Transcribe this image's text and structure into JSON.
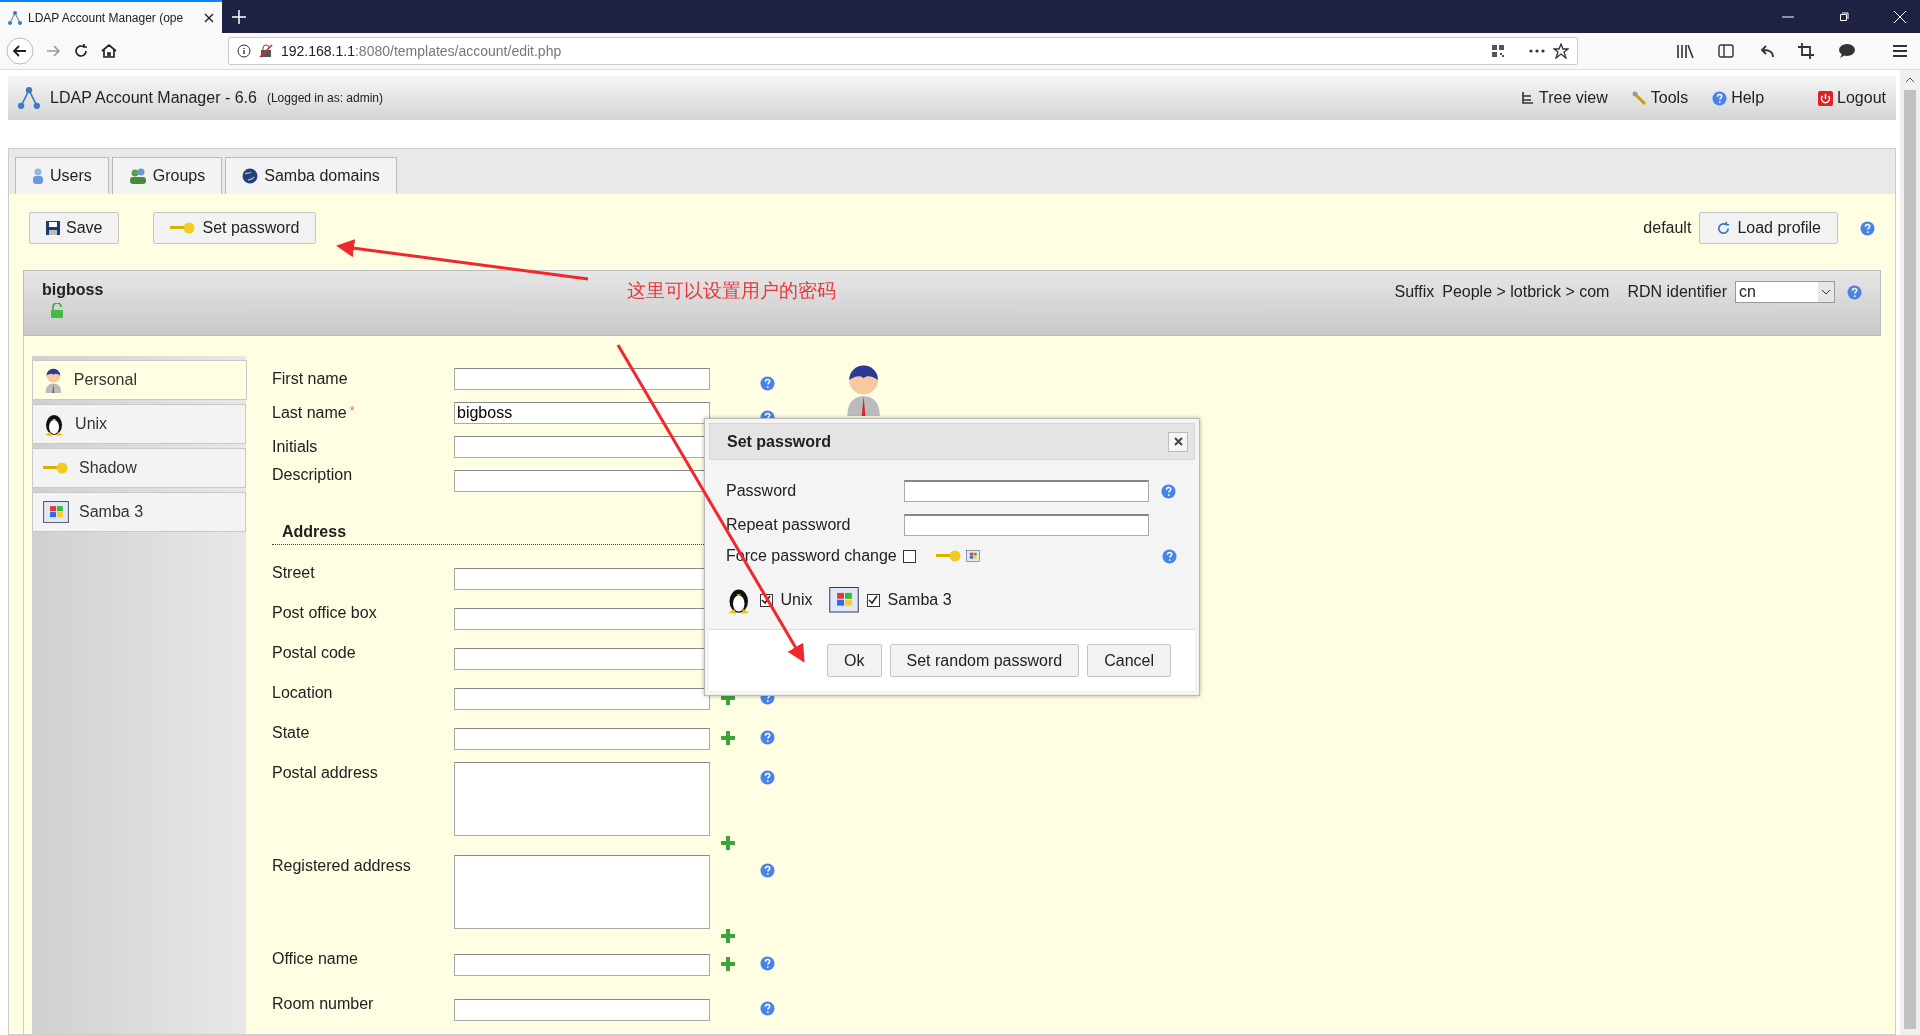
{
  "browser": {
    "tab_title": "LDAP Account Manager (ope",
    "url_host": "192.168.1.1",
    "url_rest": ":8080/templates/account/edit.php"
  },
  "app": {
    "title": "LDAP Account Manager - 6.6",
    "logged_in": "(Logged in as: admin)",
    "links": [
      {
        "kind": "tree",
        "label": "Tree view"
      },
      {
        "kind": "tools",
        "label": "Tools"
      },
      {
        "kind": "help",
        "label": "Help"
      },
      {
        "kind": "logout",
        "label": "Logout"
      }
    ]
  },
  "tabs": [
    {
      "kind": "users",
      "label": "Users"
    },
    {
      "kind": "groups",
      "label": "Groups"
    },
    {
      "kind": "domains",
      "label": "Samba domains"
    }
  ],
  "toolbar": {
    "save": "Save",
    "set_password": "Set password",
    "profile": "default",
    "load_profile": "Load profile"
  },
  "account": {
    "name": "bigboss",
    "suffix_label": "Suffix",
    "suffix": "People > lotbrick > com",
    "rdn_label": "RDN identifier",
    "rdn_value": "cn"
  },
  "modules": [
    {
      "kind": "personal",
      "label": "Personal",
      "selected": true
    },
    {
      "kind": "unix",
      "label": "Unix",
      "selected": false
    },
    {
      "kind": "shadow",
      "label": "Shadow",
      "selected": false
    },
    {
      "kind": "samba",
      "label": "Samba 3",
      "selected": false
    }
  ],
  "fields": [
    {
      "kind": "input",
      "label": "First name",
      "add": false,
      "help": true
    },
    {
      "kind": "input",
      "label": "Last name",
      "required_mark": "*",
      "value": "bigboss",
      "add": false,
      "help": true
    },
    {
      "kind": "input",
      "label": "Initials",
      "add": false,
      "help": false
    },
    {
      "kind": "input",
      "label": "Description",
      "add": false,
      "help": false
    },
    {
      "kind": "section",
      "label": "Address"
    },
    {
      "kind": "input",
      "label": "Street",
      "add": false,
      "help": false
    },
    {
      "kind": "input",
      "label": "Post office box",
      "add": false,
      "help": false
    },
    {
      "kind": "input",
      "label": "Postal code",
      "add": false,
      "help": false
    },
    {
      "kind": "input",
      "label": "Location",
      "add": true,
      "help": true
    },
    {
      "kind": "input",
      "label": "State",
      "add": true,
      "help": true
    },
    {
      "kind": "textarea",
      "label": "Postal address",
      "add": true,
      "help": true
    },
    {
      "kind": "textarea",
      "label": "Registered address",
      "add": true,
      "help": true
    },
    {
      "kind": "input",
      "label": "Office name",
      "add": true,
      "help": true
    },
    {
      "kind": "input",
      "label": "Room number",
      "add": false,
      "help": true
    }
  ],
  "dialog": {
    "title": "Set password",
    "password_label": "Password",
    "repeat_label": "Repeat password",
    "force_label": "Force password change",
    "force_checked": false,
    "targets": [
      {
        "kind": "unix",
        "label": "Unix",
        "checked": true
      },
      {
        "kind": "samba",
        "label": "Samba 3",
        "checked": true
      }
    ],
    "buttons": [
      "Ok",
      "Set random password",
      "Cancel"
    ]
  },
  "annotation": {
    "text": "这里可以设置用户的密码"
  }
}
